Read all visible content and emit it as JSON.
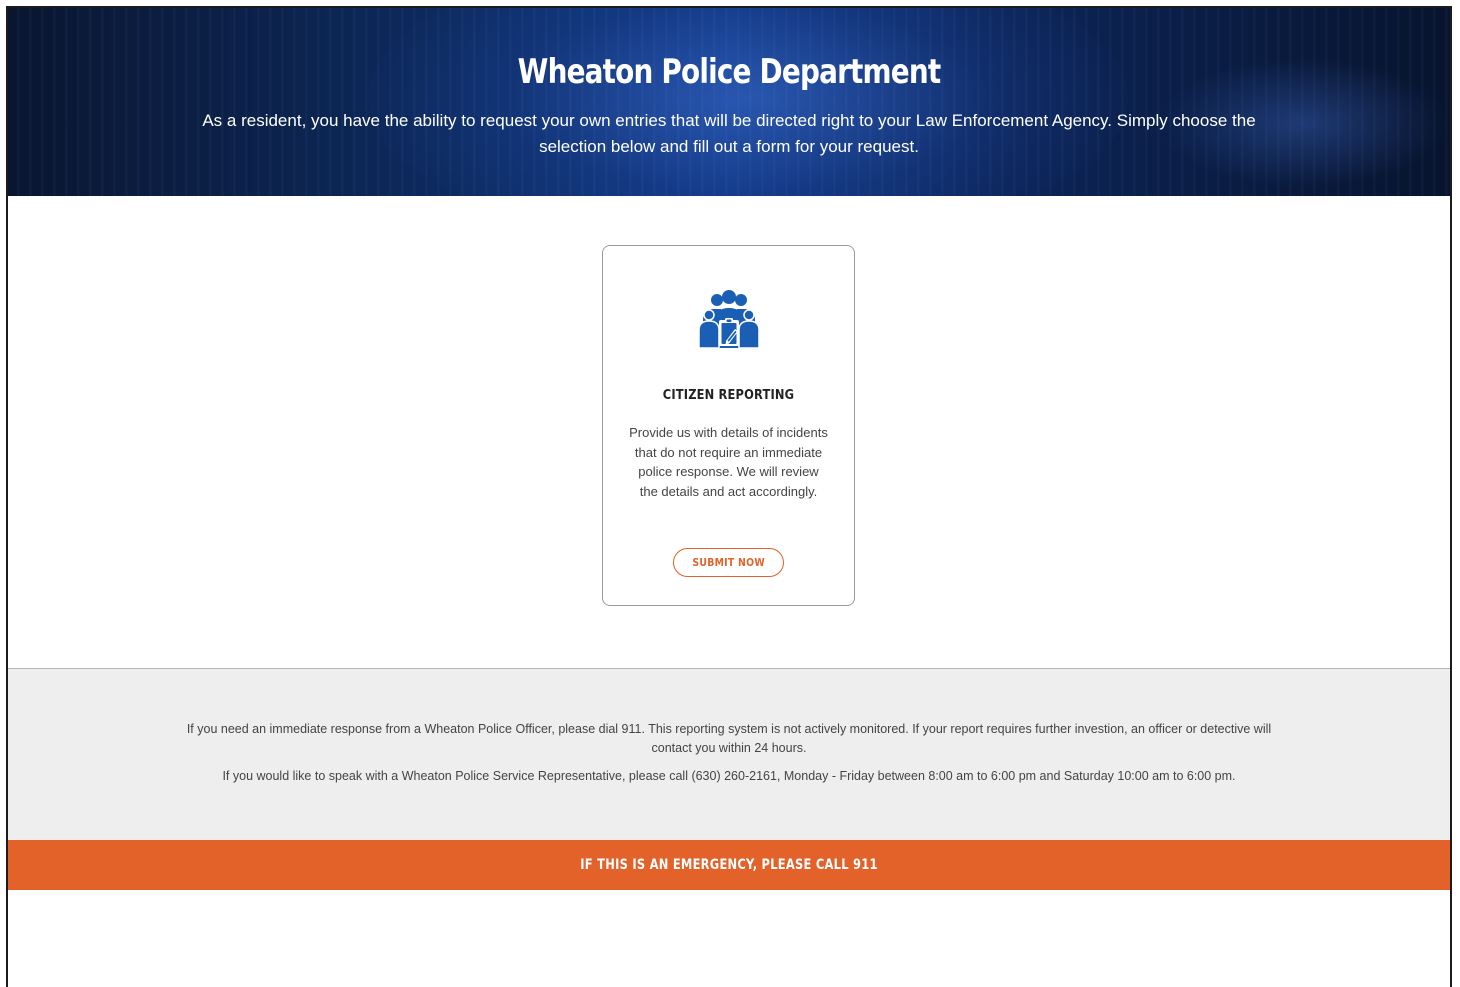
{
  "header": {
    "title": "Wheaton Police Department",
    "subtitle": "As a resident, you have the ability to request your own entries that will be directed right to your Law Enforcement Agency. Simply choose the selection below and fill out a form for your request."
  },
  "card": {
    "icon": "group-report-icon",
    "title": "CITIZEN REPORTING",
    "description": "Provide us with details of incidents that do not require an immediate police response. We will review the details and act accordingly.",
    "button_label": "SUBMIT NOW"
  },
  "info": {
    "paragraph1": "If you need an immediate response from a Wheaton Police Officer, please dial 911. This reporting system is not actively monitored. If your report requires further investion, an officer or detective will contact you within 24 hours.",
    "paragraph2": "If you would like to speak with a Wheaton Police Service Representative, please call (630) 260-2161, Monday - Friday between 8:00 am to 6:00 pm and Saturday 10:00 am to 6:00 pm."
  },
  "emergency": {
    "text": "IF THIS IS AN EMERGENCY, PLEASE CALL 911"
  },
  "colors": {
    "accent": "#e2622a",
    "hero_dark": "#0a1630",
    "icon_blue": "#1a5fb4",
    "info_bg": "#eeeeef"
  }
}
